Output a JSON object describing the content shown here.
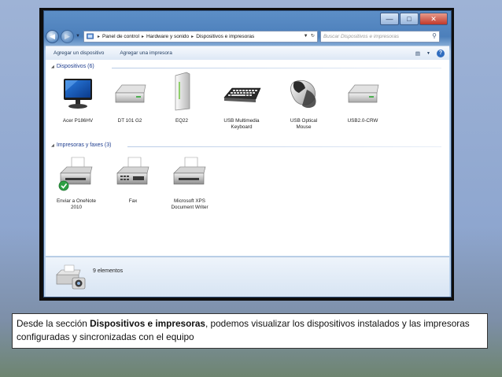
{
  "breadcrumb": [
    "Panel de control",
    "Hardware y sonido",
    "Dispositivos e impresoras"
  ],
  "search": {
    "placeholder": "Buscar Dispositivos e impresoras"
  },
  "toolbar": {
    "add_device": "Agregar un dispositivo",
    "add_printer": "Agregar una impresora",
    "help": "?"
  },
  "groups": {
    "devices": {
      "title": "Dispositivos (6)"
    },
    "printers": {
      "title": "Impresoras y faxes (3)"
    }
  },
  "devices": [
    {
      "line1": "Acer P186HV",
      "line2": "",
      "icon": "monitor-icon"
    },
    {
      "line1": "DT 101 G2",
      "line2": "",
      "icon": "usb-drive-icon"
    },
    {
      "line1": "EQ22",
      "line2": "",
      "icon": "external-drive-icon"
    },
    {
      "line1": "USB Multimedia",
      "line2": "Keyboard",
      "icon": "keyboard-icon"
    },
    {
      "line1": "USB Optical",
      "line2": "Mouse",
      "icon": "mouse-icon"
    },
    {
      "line1": "USB2.0-CRW",
      "line2": "",
      "icon": "card-reader-icon"
    }
  ],
  "printers": [
    {
      "line1": "Enviar a OneNote",
      "line2": "2010",
      "icon": "printer-default-icon"
    },
    {
      "line1": "Fax",
      "line2": "",
      "icon": "fax-icon"
    },
    {
      "line1": "Microsoft XPS",
      "line2": "Document Writer",
      "icon": "printer-icon"
    }
  ],
  "details": {
    "count": "9 elementos"
  },
  "caption": {
    "pre": "Desde la sección ",
    "bold": "Dispositivos e impresoras",
    "post": ", podemos visualizar los dispositivos instalados y las impresoras configuradas y sincronizadas con el equipo"
  },
  "colors": {
    "accent": "#1e3d8f",
    "window_frame": "#4c7fbb",
    "close": "#c0392b",
    "default_check": "#2ea043"
  }
}
